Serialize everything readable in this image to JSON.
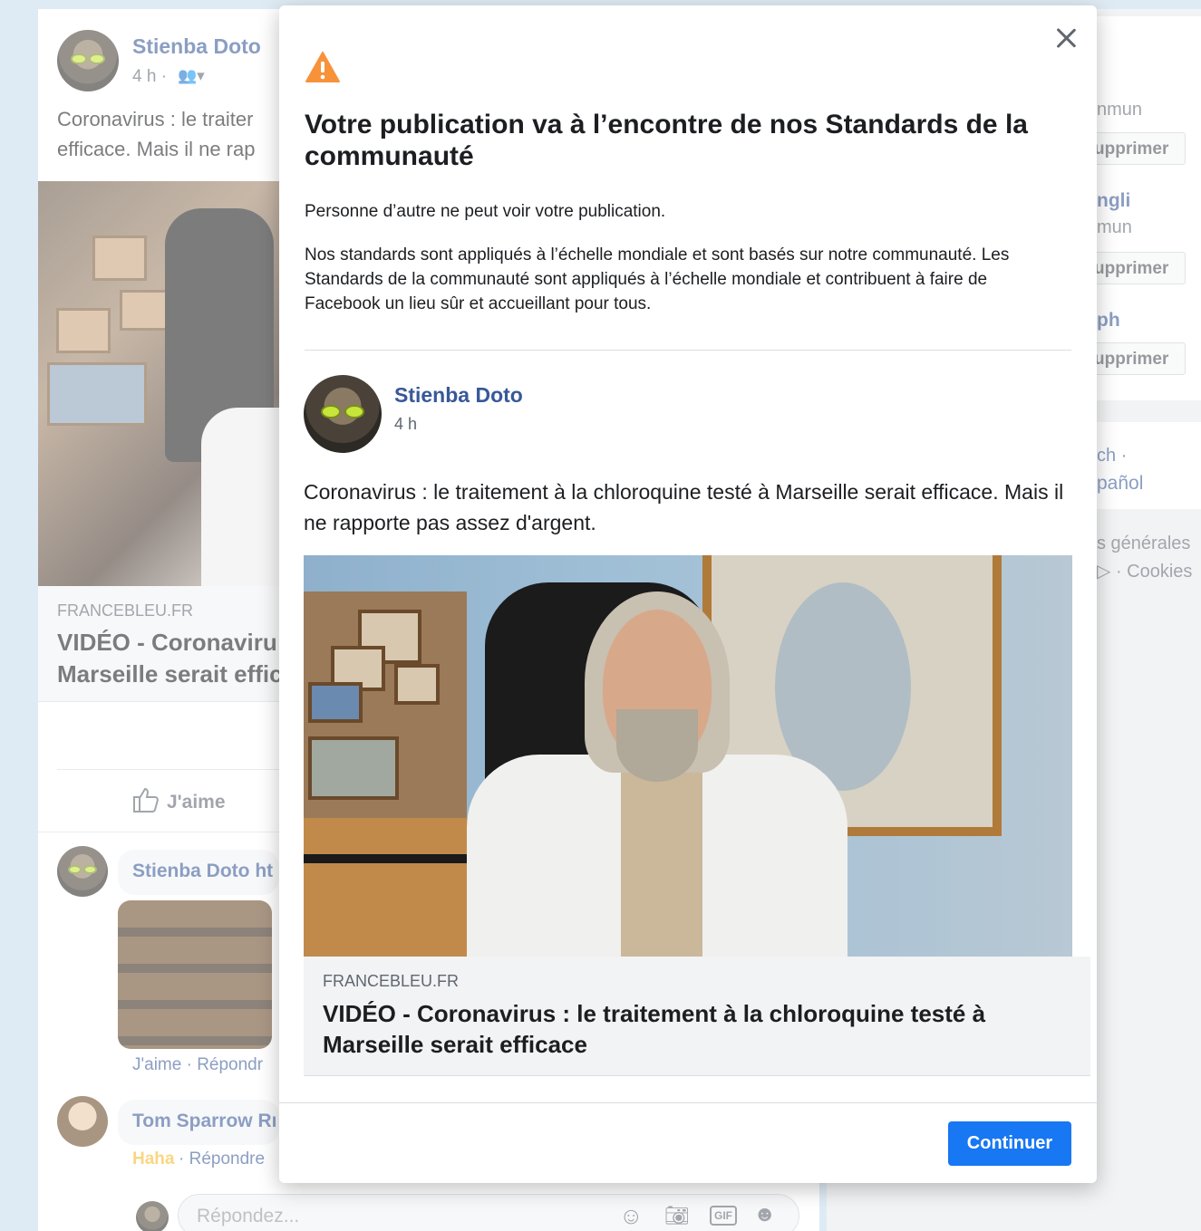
{
  "background": {
    "post": {
      "author": "Stienba Doto",
      "time": "4 h ·",
      "text_line1": "Coronavirus : le traiter",
      "text_line2": "efficace. Mais il ne rap",
      "link_domain": "FRANCEBLEU.FR",
      "link_title_line1": "VIDÉO - Coronaviru",
      "link_title_line2": "Marseille serait effic",
      "like_label": "J'aime"
    },
    "comments": [
      {
        "author": "Stienba Doto ht",
        "actions": "J'aime · Répondr"
      },
      {
        "author": "Tom Sparrow Rı",
        "reaction": "Haha",
        "actions": " · Répondre"
      }
    ],
    "reply_placeholder": "Répondez...",
    "sidebar": {
      "texts": [
        "nmun",
        "ngli",
        "mun",
        "ph",
        "ch ·",
        "pañol",
        "s générales",
        "▷ · Cookies"
      ],
      "remove_label": "upprimer"
    }
  },
  "modal": {
    "title": "Votre publication va à l’encontre de nos Standards de la communauté",
    "notice": "Personne d’autre ne peut voir votre publication.",
    "explanation": "Nos standards sont appliqués à l’échelle mondiale et sont basés sur notre communauté. Les Standards de la communauté sont appliqués à l’échelle mondiale et contribuent à faire de Facebook un lieu sûr et accueillant pour tous.",
    "post": {
      "author": "Stienba Doto",
      "time": "4 h",
      "text": "Coronavirus : le traitement à la chloroquine testé à Marseille serait efficace. Mais il ne rapporte pas assez d'argent.",
      "link_domain": "FRANCEBLEU.FR",
      "link_title": "VIDÉO - Coronavirus : le traitement à la chloroquine testé à Marseille serait efficace"
    },
    "continue_label": "Continuer"
  },
  "colors": {
    "accent": "#1877f2",
    "link_name": "#385898",
    "warning": "#f7923b"
  },
  "icons": [
    "warning-icon",
    "close-icon",
    "like-icon",
    "friends-icon",
    "emoji-icon",
    "camera-icon",
    "gif-icon",
    "sticker-icon"
  ]
}
